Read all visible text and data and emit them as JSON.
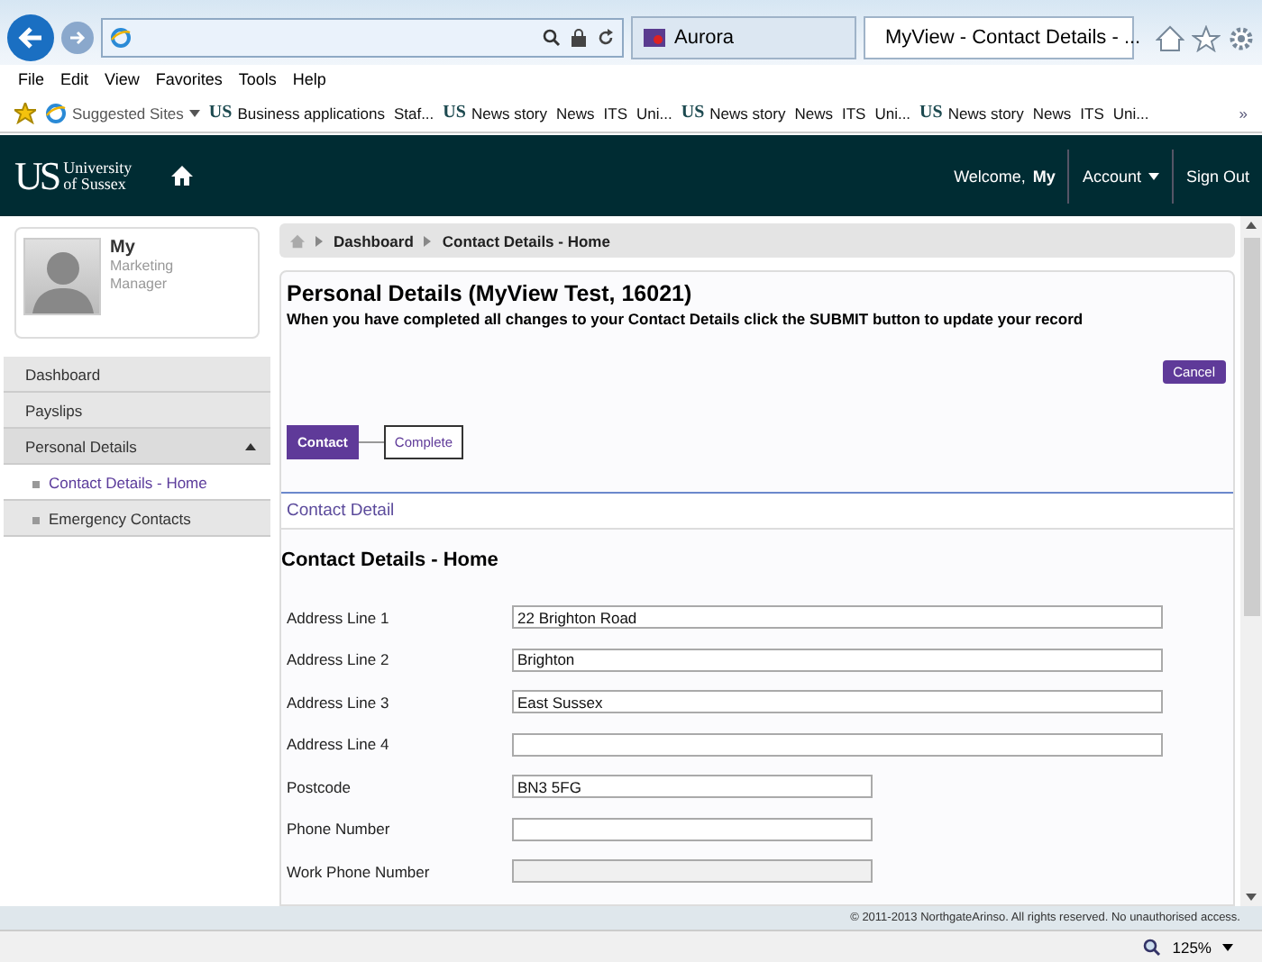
{
  "browser": {
    "tabs": [
      {
        "title": "Aurora",
        "selected": false
      },
      {
        "title": "MyView - Contact Details - ...",
        "selected": true
      }
    ],
    "menu": [
      "File",
      "Edit",
      "View",
      "Favorites",
      "Tools",
      "Help"
    ],
    "favorites": [
      {
        "label": "Suggested Sites",
        "kind": "ie"
      },
      {
        "label": "Business applications",
        "kind": "us",
        "logo": "US"
      },
      {
        "label": "Staf...",
        "kind": "plain"
      },
      {
        "label": "News story",
        "kind": "us",
        "logo": "US"
      },
      {
        "label": "News",
        "kind": "plain"
      },
      {
        "label": "ITS",
        "kind": "plain"
      },
      {
        "label": "Uni...",
        "kind": "plain"
      },
      {
        "label": "News story",
        "kind": "us",
        "logo": "US"
      },
      {
        "label": "News",
        "kind": "plain"
      },
      {
        "label": "ITS",
        "kind": "plain"
      },
      {
        "label": "Uni...",
        "kind": "plain"
      },
      {
        "label": "News story",
        "kind": "us",
        "logo": "US"
      },
      {
        "label": "News",
        "kind": "plain"
      },
      {
        "label": "ITS",
        "kind": "plain"
      },
      {
        "label": "Uni...",
        "kind": "plain"
      }
    ],
    "more": "»",
    "zoom": "125%"
  },
  "header": {
    "logo_mark": "US",
    "logo_text": [
      "University",
      "of Sussex"
    ],
    "welcome": "Welcome,",
    "user": "My",
    "account": "Account",
    "sign_out": "Sign Out"
  },
  "profile": {
    "name": "My",
    "role": "Marketing Manager"
  },
  "sidebar": {
    "items": [
      {
        "label": "Dashboard",
        "selected": false
      },
      {
        "label": "Payslips",
        "selected": false
      },
      {
        "label": "Personal Details",
        "selected": false,
        "expanded": true,
        "children": [
          {
            "label": "Contact Details - Home",
            "selected": true
          },
          {
            "label": "Emergency Contacts",
            "selected": false
          }
        ]
      }
    ]
  },
  "breadcrumb": [
    "Dashboard",
    "Contact Details - Home"
  ],
  "panel": {
    "title": "Personal Details (MyView Test, 16021)",
    "instruction": "When you have completed all changes to your Contact Details click the SUBMIT button to update your record",
    "cancel": "Cancel",
    "steps": [
      {
        "label": "Contact",
        "selected": true
      },
      {
        "label": "Complete",
        "selected": false
      }
    ],
    "section": "Contact Detail",
    "heading": "Contact Details - Home",
    "fields": [
      {
        "label": "Address Line 1",
        "value": "22 Brighton Road",
        "wide": true,
        "disabled": false
      },
      {
        "label": "Address Line 2",
        "value": "Brighton",
        "wide": true,
        "disabled": false
      },
      {
        "label": "Address Line 3",
        "value": "East Sussex",
        "wide": true,
        "disabled": false
      },
      {
        "label": "Address Line 4",
        "wide": true,
        "disabled": false
      },
      {
        "label": "Postcode",
        "value": "BN3 5FG",
        "wide": false,
        "disabled": false
      },
      {
        "label": "Phone Number",
        "wide": false,
        "disabled": false
      },
      {
        "label": "Work Phone Number",
        "wide": false,
        "disabled": true
      }
    ]
  },
  "footer": "© 2011-2013 NorthgateArinso. All rights reserved. No unauthorised access."
}
